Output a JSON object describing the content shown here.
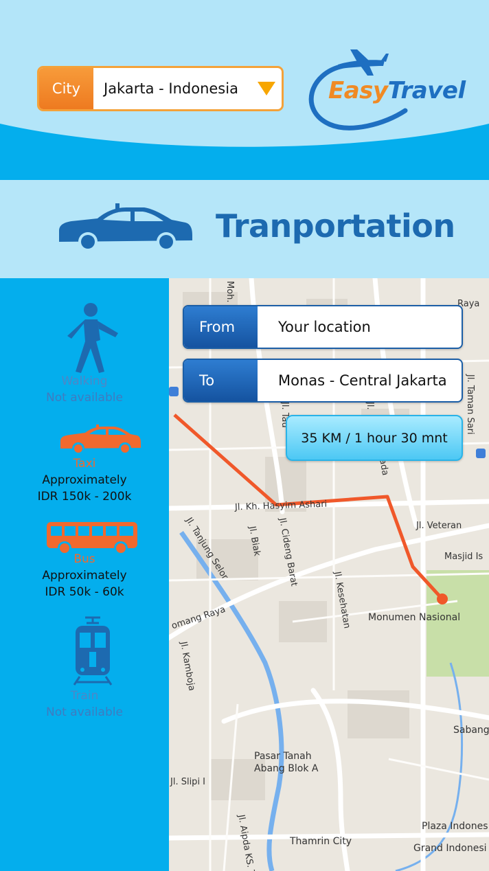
{
  "header": {
    "city_label": "City",
    "city_value": "Jakarta - Indonesia",
    "logo_easy": "Easy",
    "logo_travel": "Travel"
  },
  "title": "Tranportation",
  "route": {
    "from_label": "From",
    "from_value": "Your location",
    "to_label": "To",
    "to_value": "Monas - Central Jakarta",
    "distance": "35 KM / 1 hour 30 mnt"
  },
  "modes": [
    {
      "name": "Walking",
      "note": "Not available",
      "icon": "walking-person-icon"
    },
    {
      "name": "Taxi",
      "note": "Approximately\nIDR 150k - 200k",
      "icon": "taxi-icon"
    },
    {
      "name": "Bus",
      "note": "Approximately\nIDR 50k - 60k",
      "icon": "bus-icon"
    },
    {
      "name": "Train",
      "note": "Not available",
      "icon": "train-icon"
    }
  ],
  "map_labels": {
    "moh": "Moh.",
    "raya": "Raya",
    "taman_sari": "Jl. Taman Sari",
    "hasyim_ashari": "Jl. Kh. Hasyim Ashari",
    "veteran": "Jl. Veteran",
    "masjid": "Masjid Is",
    "tanjung_selor": "Jl. Tanjung Selor",
    "biak": "Jl. Biak",
    "cideng_barat": "Jl. Cideng Barat",
    "kesehatan": "Jl. Kesehatan",
    "monumen": "Monumen Nasional",
    "omang_raya": "omang Raya",
    "kamboja": "Jl. Kamboja",
    "sabang": "Sabang",
    "pasar_tanah": "Pasar Tanah",
    "abang_blok": "Abang Blok A",
    "slipi": "Jl. Slipi I",
    "plaza_indones": "Plaza Indones",
    "thamrin_city": "Thamrin City",
    "grand_indonesi": "Grand Indonesi",
    "ks_tubun": "Jl. Aipda KS. Tubun",
    "tau": "Jl. Tau",
    "jl_top": "Jl.",
    "ada": "ada"
  },
  "colors": {
    "header_bg": "#b3e5f9",
    "header_band": "#04aeed",
    "sidebar_bg": "#04aeed",
    "title_blue": "#1d6ab0",
    "accent_orange": "#f1692e",
    "route_line": "#f0582a",
    "map_bg": "#ebe7df",
    "park_green": "#c8dfa8"
  }
}
